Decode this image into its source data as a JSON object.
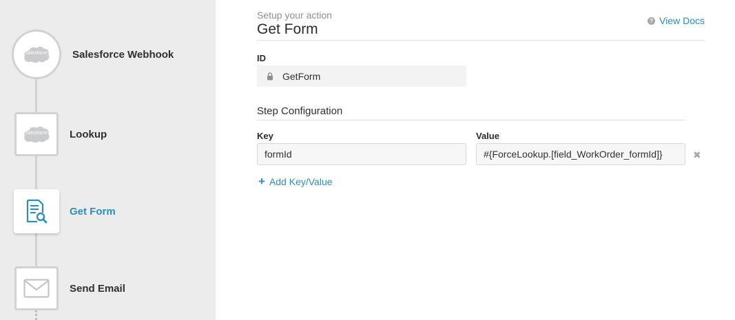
{
  "workflow": {
    "steps": [
      {
        "label": "Salesforce Webhook",
        "icon": "salesforce-cloud-icon",
        "icon_text": "salesforce",
        "shape": "circle"
      },
      {
        "label": "Lookup",
        "icon": "salesforce-cloud-icon",
        "icon_text": "salesforce",
        "shape": "square"
      },
      {
        "label": "Get Form",
        "icon": "form-search-icon",
        "shape": "square",
        "active": true
      },
      {
        "label": "Send Email",
        "icon": "envelope-icon",
        "shape": "square"
      }
    ]
  },
  "header": {
    "subheading": "Setup your action",
    "title": "Get Form",
    "docs_link": "View Docs"
  },
  "id_section": {
    "label": "ID",
    "value": "GetForm"
  },
  "step_config": {
    "title": "Step Configuration",
    "key_header": "Key",
    "value_header": "Value",
    "rows": [
      {
        "key": "formId",
        "value": "#{ForceLookup.[field_WorkOrder_formId]}"
      }
    ],
    "add_label": "Add Key/Value"
  },
  "colors": {
    "accent": "#2a8fb8",
    "sidebar_bg": "#ececed",
    "connector": "#cfd2d4"
  }
}
